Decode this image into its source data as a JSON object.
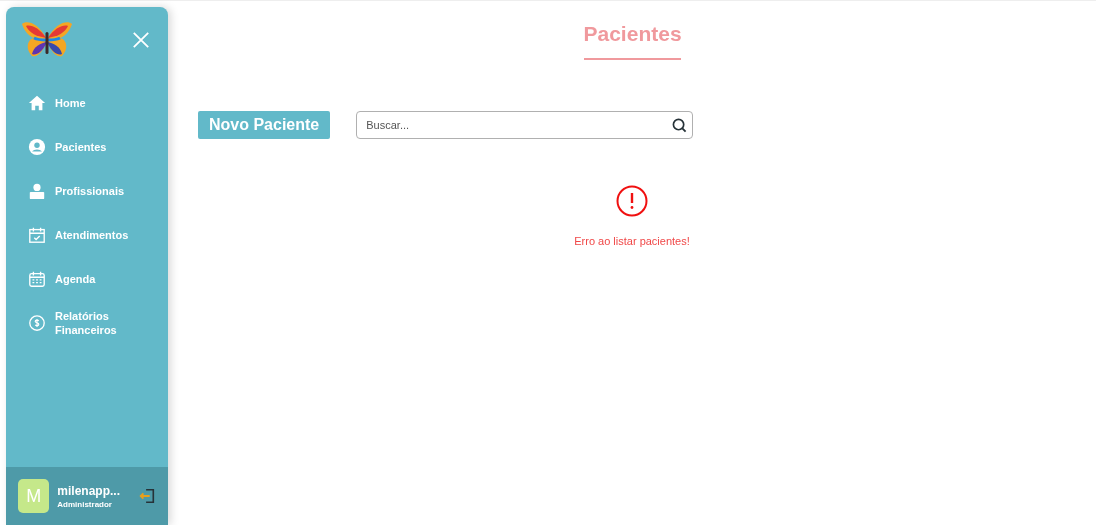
{
  "sidebar": {
    "nav": [
      {
        "kind": "home",
        "label": "Home"
      },
      {
        "kind": "patient",
        "label": "Pacientes"
      },
      {
        "kind": "professional",
        "label": "Profissionais"
      },
      {
        "kind": "appointments",
        "label": "Atendimentos"
      },
      {
        "kind": "calendar",
        "label": "Agenda"
      },
      {
        "kind": "money",
        "label": "Relatórios Financeiros"
      }
    ],
    "user": {
      "initial": "M",
      "name": "milenapp...",
      "role": "Administrador"
    }
  },
  "page": {
    "title": "Pacientes",
    "new_button": "Novo Paciente",
    "search": {
      "placeholder": "Buscar..."
    },
    "error": "Erro ao listar pacientes!"
  }
}
